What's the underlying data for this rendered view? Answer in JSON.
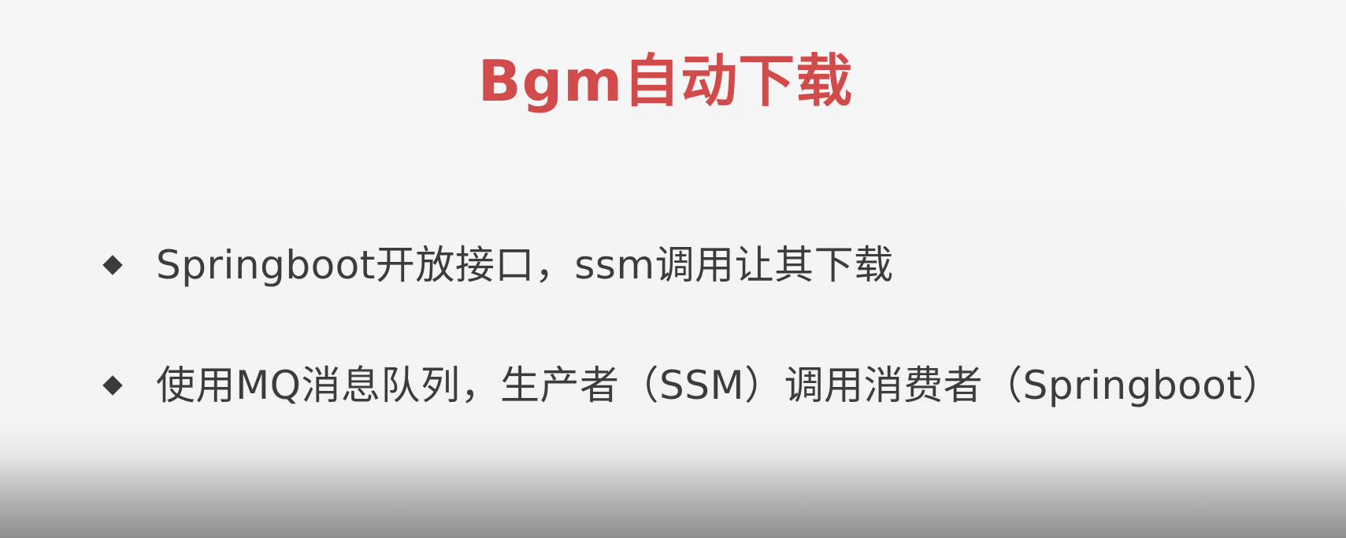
{
  "slide": {
    "title": "Bgm自动下载",
    "title_color": "#d24b4b",
    "bullet_icon": "diamond-bullet-icon",
    "bullets": [
      {
        "text": "Springboot开放接口，ssm调用让其下载"
      },
      {
        "text": "使用MQ消息队列，生产者（SSM）调用消费者（Springboot）"
      }
    ]
  }
}
